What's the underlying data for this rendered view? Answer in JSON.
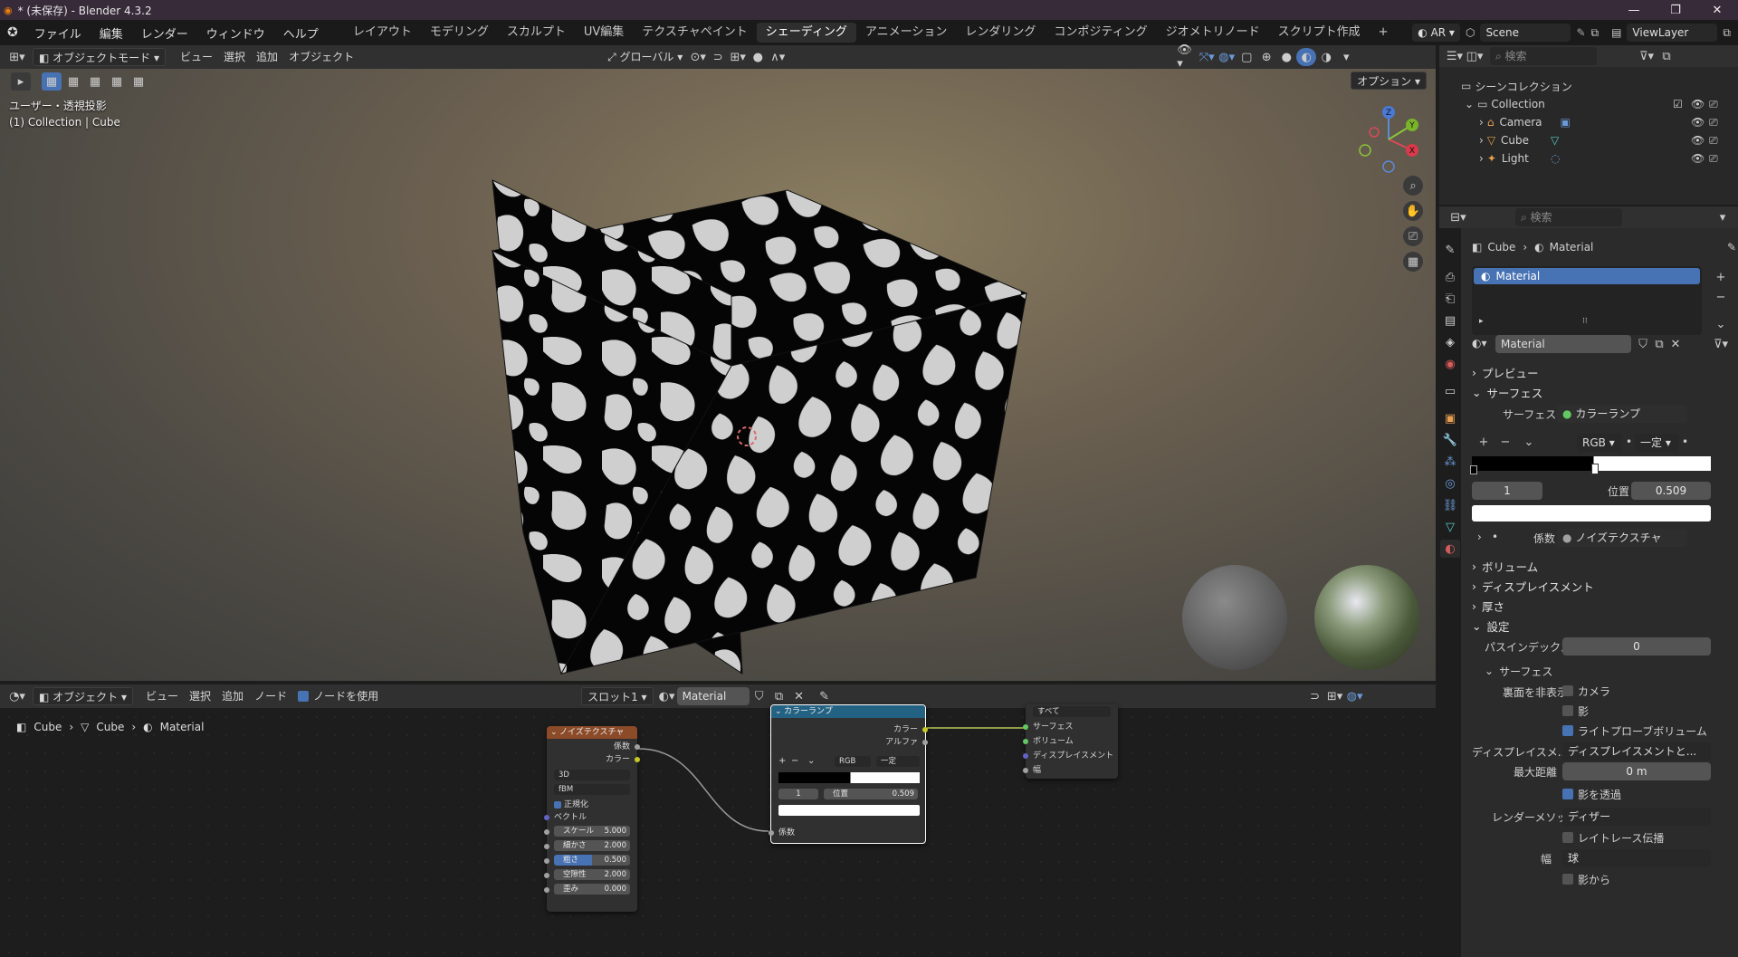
{
  "window": {
    "title": "* (未保存) - Blender 4.3.2",
    "controls": [
      "—",
      "❐",
      "✕"
    ]
  },
  "topbar": {
    "menus": [
      "ファイル",
      "編集",
      "レンダー",
      "ウィンドウ",
      "ヘルプ"
    ],
    "workspaces": [
      "レイアウト",
      "モデリング",
      "スカルプト",
      "UV編集",
      "テクスチャペイント",
      "シェーディング",
      "アニメーション",
      "レンダリング",
      "コンポジティング",
      "ジオメトリノード",
      "スクリプト作成"
    ],
    "active_workspace": "シェーディング",
    "add_tab": "+",
    "ar_label": "AR",
    "scene": "Scene",
    "view_layer": "ViewLayer"
  },
  "viewport": {
    "mode": "オブジェクトモード",
    "menus": [
      "ビュー",
      "選択",
      "追加",
      "オブジェクト"
    ],
    "orientation": "グローバル",
    "options_label": "オプション",
    "overlay_line1": "ユーザー・透視投影",
    "overlay_line2": "(1) Collection | Cube",
    "gizmo": {
      "x": "X",
      "y": "Y",
      "z": "Z"
    }
  },
  "outliner": {
    "search_placeholder": "検索",
    "root": "シーンコレクション",
    "collection": "Collection",
    "items": [
      "Camera",
      "Cube",
      "Light"
    ]
  },
  "properties": {
    "search_placeholder": "検索",
    "breadcrumb": {
      "object": "Cube",
      "material": "Material"
    },
    "slot_name": "Material",
    "material_name": "Material",
    "sections": {
      "preview": "プレビュー",
      "surface": "サーフェス",
      "volume": "ボリューム",
      "displacement": "ディスプレイスメント",
      "thickness": "厚さ",
      "settings": "設定"
    },
    "surface": {
      "label": "サーフェス",
      "value": "カラーランプ",
      "color_mode": "RGB",
      "interpolation": "一定",
      "stop_index": "1",
      "position_label": "位置",
      "position_value": "0.509",
      "fac_label": "係数",
      "fac_value": "ノイズテクスチャ"
    },
    "settings": {
      "pass_index_label": "パスインデックス",
      "pass_index_value": "0",
      "surface_sub": "サーフェス",
      "backface_label": "裏面を非表示",
      "camera": "カメラ",
      "shadow": "影",
      "light_probe": "ライトプローブボリューム",
      "displacement_label": "ディスプレイスメ...",
      "displacement_value": "ディスプレイスメントと...",
      "max_distance_label": "最大距離",
      "max_distance_value": "0 m",
      "transparent_shadow": "影を透過",
      "render_method_label": "レンダーメソッド",
      "render_method_value": "ディザー",
      "raytrace": "レイトレース伝播",
      "thickness_label": "幅",
      "thickness_value": "球",
      "from_shadow": "影から"
    }
  },
  "node_editor": {
    "mode": "オブジェクト",
    "menus": [
      "ビュー",
      "選択",
      "追加",
      "ノード"
    ],
    "use_nodes": "ノードを使用",
    "slot": "スロット1",
    "material": "Material",
    "breadcrumb": [
      "Cube",
      "Cube",
      "Material"
    ],
    "noise_node": {
      "title": "ノイズテクスチャ",
      "out_fac": "係数",
      "out_color": "カラー",
      "dim": "3D",
      "type": "fBM",
      "normalize": "正規化",
      "vector": "ベクトル",
      "scale_label": "スケール",
      "scale": "5.000",
      "detail_label": "細かさ",
      "detail": "2.000",
      "roughness_label": "粗さ",
      "roughness": "0.500",
      "lacunarity_label": "空隙性",
      "lacunarity": "2.000",
      "distortion_label": "歪み",
      "distortion": "0.000"
    },
    "ramp_node": {
      "title": "カラーランプ",
      "out_color": "カラー",
      "out_alpha": "アルファ",
      "mode": "RGB",
      "interp": "一定",
      "index": "1",
      "pos_label": "位置",
      "pos": "0.509",
      "in_fac": "係数"
    },
    "output_node": {
      "target": "すべて",
      "surface": "サーフェス",
      "volume": "ボリューム",
      "displacement": "ディスプレイスメント",
      "thickness": "幅"
    }
  },
  "colors": {
    "accent": "#4772b3",
    "noise_header": "#8b4a28",
    "ramp_header": "#246283"
  }
}
